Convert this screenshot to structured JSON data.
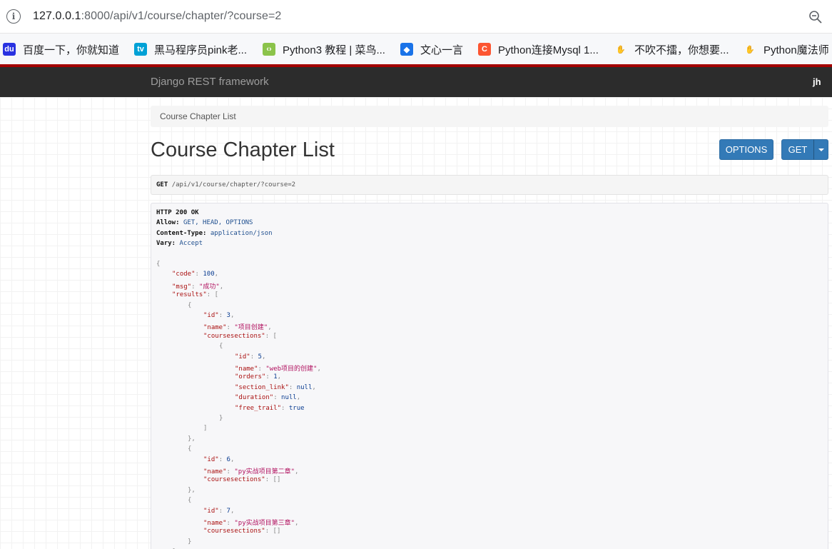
{
  "browser": {
    "url_host": "127.0.0.1",
    "url_rest": ":8000/api/v1/course/chapter/?course=2",
    "bookmarks": [
      {
        "label": "百度一下，你就知道",
        "icon": "baidu-paw-icon",
        "color": "#2932e1"
      },
      {
        "label": "黑马程序员pink老...",
        "icon": "bilibili-tv-icon",
        "color": "#00a1d6"
      },
      {
        "label": "Python3 教程 | 菜鸟...",
        "icon": "runoob-icon",
        "color": "#8bc34a"
      },
      {
        "label": "文心一言",
        "icon": "wenxin-cube-icon",
        "color": "#1a73e8"
      },
      {
        "label": "Python连接Mysql 1...",
        "icon": "csdn-c-icon",
        "color": "#fc5531"
      },
      {
        "label": "不吹不擂，你想要...",
        "icon": "zhihu-hand-icon",
        "color": "#555555"
      },
      {
        "label": "Python魔法师",
        "icon": "zhihu-hand-icon",
        "color": "#555555"
      }
    ]
  },
  "navbar": {
    "brand": "Django REST framework",
    "user": "jh"
  },
  "breadcrumb": "Course Chapter List",
  "title": "Course Chapter List",
  "buttons": {
    "options": "OPTIONS",
    "get": "GET"
  },
  "request": {
    "method": "GET",
    "path": "/api/v1/course/chapter/?course=2"
  },
  "response_headers": [
    {
      "key": "HTTP 200 OK",
      "value": ""
    },
    {
      "key": "Allow:",
      "value": "GET, HEAD, OPTIONS"
    },
    {
      "key": "Content-Type:",
      "value": "application/json"
    },
    {
      "key": "Vary:",
      "value": "Accept"
    }
  ],
  "json_lines": [
    {
      "indent": 0,
      "parts": [
        [
          "p",
          "{"
        ]
      ]
    },
    {
      "indent": 1,
      "parts": [
        [
          "k",
          "\"code\""
        ],
        [
          "p",
          ": "
        ],
        [
          "n",
          "100"
        ],
        [
          "p",
          ","
        ]
      ]
    },
    {
      "indent": 1,
      "parts": [
        [
          "k",
          "\"msg\""
        ],
        [
          "p",
          ": "
        ],
        [
          "s",
          "\"成功\""
        ],
        [
          "p",
          ","
        ]
      ]
    },
    {
      "indent": 1,
      "parts": [
        [
          "k",
          "\"results\""
        ],
        [
          "p",
          ": ["
        ]
      ]
    },
    {
      "indent": 2,
      "parts": [
        [
          "p",
          "{"
        ]
      ]
    },
    {
      "indent": 3,
      "parts": [
        [
          "k",
          "\"id\""
        ],
        [
          "p",
          ": "
        ],
        [
          "n",
          "3"
        ],
        [
          "p",
          ","
        ]
      ]
    },
    {
      "indent": 3,
      "parts": [
        [
          "k",
          "\"name\""
        ],
        [
          "p",
          ": "
        ],
        [
          "s",
          "\"项目创建\""
        ],
        [
          "p",
          ","
        ]
      ]
    },
    {
      "indent": 3,
      "parts": [
        [
          "k",
          "\"coursesections\""
        ],
        [
          "p",
          ": ["
        ]
      ]
    },
    {
      "indent": 4,
      "parts": [
        [
          "p",
          "{"
        ]
      ]
    },
    {
      "indent": 5,
      "parts": [
        [
          "k",
          "\"id\""
        ],
        [
          "p",
          ": "
        ],
        [
          "n",
          "5"
        ],
        [
          "p",
          ","
        ]
      ]
    },
    {
      "indent": 5,
      "parts": [
        [
          "k",
          "\"name\""
        ],
        [
          "p",
          ": "
        ],
        [
          "s",
          "\"web项目的创建\""
        ],
        [
          "p",
          ","
        ]
      ]
    },
    {
      "indent": 5,
      "parts": [
        [
          "k",
          "\"orders\""
        ],
        [
          "p",
          ": "
        ],
        [
          "n",
          "1"
        ],
        [
          "p",
          ","
        ]
      ]
    },
    {
      "indent": 5,
      "parts": [
        [
          "k",
          "\"section_link\""
        ],
        [
          "p",
          ": "
        ],
        [
          "n",
          "null"
        ],
        [
          "p",
          ","
        ]
      ]
    },
    {
      "indent": 5,
      "parts": [
        [
          "k",
          "\"duration\""
        ],
        [
          "p",
          ": "
        ],
        [
          "n",
          "null"
        ],
        [
          "p",
          ","
        ]
      ]
    },
    {
      "indent": 5,
      "parts": [
        [
          "k",
          "\"free_trail\""
        ],
        [
          "p",
          ": "
        ],
        [
          "n",
          "true"
        ]
      ]
    },
    {
      "indent": 4,
      "parts": [
        [
          "p",
          "}"
        ]
      ]
    },
    {
      "indent": 3,
      "parts": [
        [
          "p",
          "]"
        ]
      ]
    },
    {
      "indent": 2,
      "parts": [
        [
          "p",
          "},"
        ]
      ]
    },
    {
      "indent": 2,
      "parts": [
        [
          "p",
          "{"
        ]
      ]
    },
    {
      "indent": 3,
      "parts": [
        [
          "k",
          "\"id\""
        ],
        [
          "p",
          ": "
        ],
        [
          "n",
          "6"
        ],
        [
          "p",
          ","
        ]
      ]
    },
    {
      "indent": 3,
      "parts": [
        [
          "k",
          "\"name\""
        ],
        [
          "p",
          ": "
        ],
        [
          "s",
          "\"py实战项目第二章\""
        ],
        [
          "p",
          ","
        ]
      ]
    },
    {
      "indent": 3,
      "parts": [
        [
          "k",
          "\"coursesections\""
        ],
        [
          "p",
          ": []"
        ]
      ]
    },
    {
      "indent": 2,
      "parts": [
        [
          "p",
          "},"
        ]
      ]
    },
    {
      "indent": 2,
      "parts": [
        [
          "p",
          "{"
        ]
      ]
    },
    {
      "indent": 3,
      "parts": [
        [
          "k",
          "\"id\""
        ],
        [
          "p",
          ": "
        ],
        [
          "n",
          "7"
        ],
        [
          "p",
          ","
        ]
      ]
    },
    {
      "indent": 3,
      "parts": [
        [
          "k",
          "\"name\""
        ],
        [
          "p",
          ": "
        ],
        [
          "s",
          "\"py实战项目第三章\""
        ],
        [
          "p",
          ","
        ]
      ]
    },
    {
      "indent": 3,
      "parts": [
        [
          "k",
          "\"coursesections\""
        ],
        [
          "p",
          ": []"
        ]
      ]
    },
    {
      "indent": 2,
      "parts": [
        [
          "p",
          "}"
        ]
      ]
    },
    {
      "indent": 1,
      "parts": [
        [
          "p",
          "]"
        ]
      ]
    }
  ]
}
